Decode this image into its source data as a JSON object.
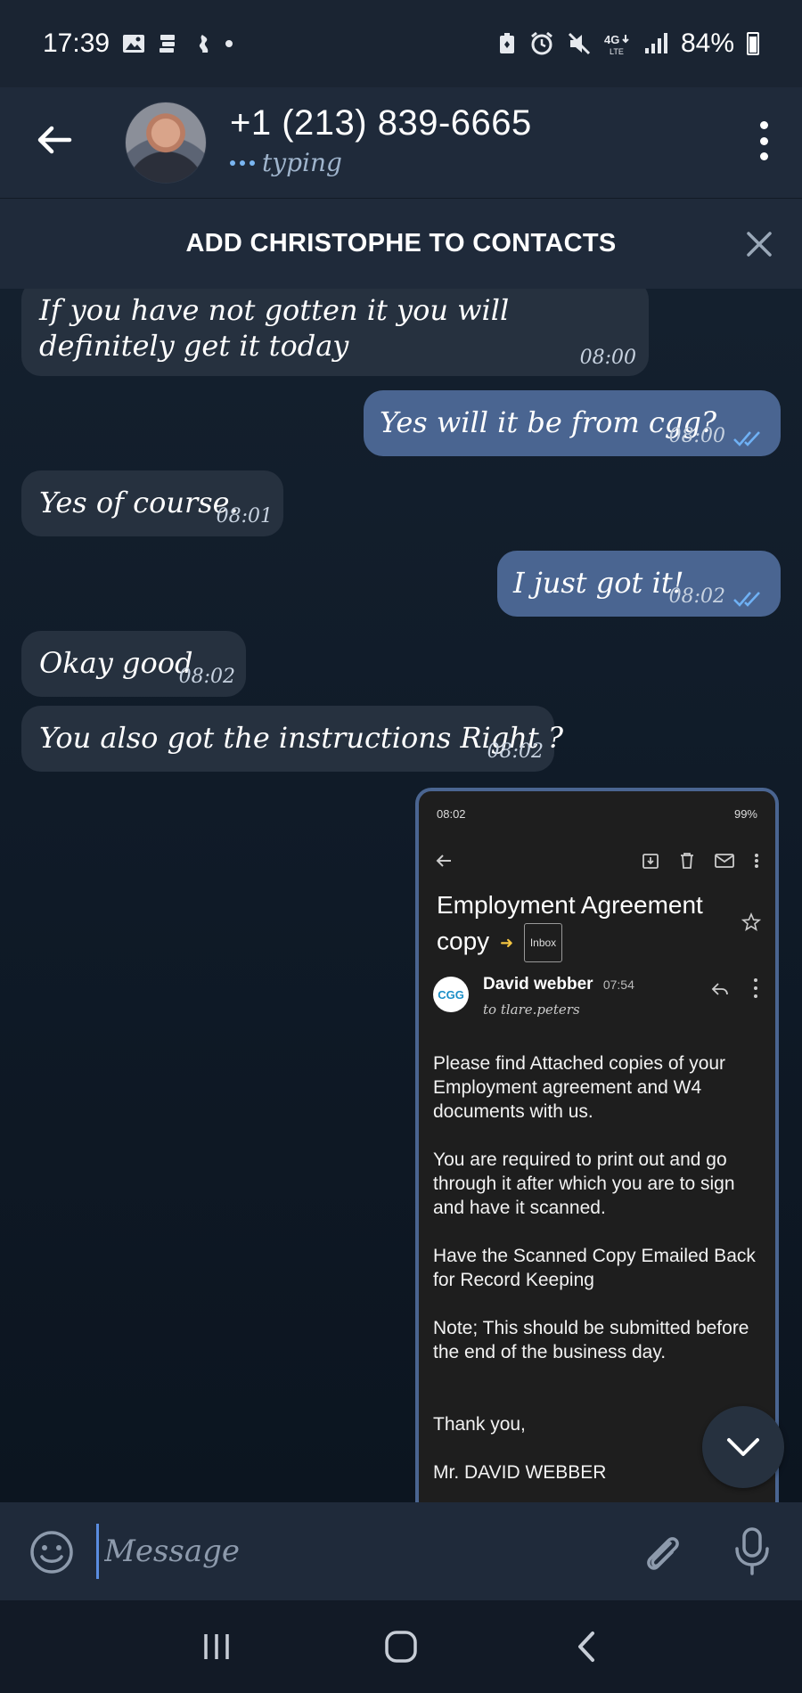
{
  "status_bar": {
    "time": "17:39",
    "battery": "84%",
    "network": "4G LTE",
    "left_icons": [
      "gallery-icon",
      "app-notification-icon",
      "telegram-notification-icon",
      "dot-icon"
    ],
    "right_icons": [
      "battery-saver-icon",
      "alarm-icon",
      "mute-icon",
      "network-icon",
      "signal-icon",
      "battery-icon"
    ]
  },
  "header": {
    "contact_name": "+1 (213) 839-6665",
    "status": "typing",
    "accent": "#7ab6f2"
  },
  "banner": {
    "label": "ADD CHRISTOPHE TO CONTACTS"
  },
  "messages": [
    {
      "direction": "in",
      "text": "If you have not gotten it you will definitely get it today",
      "time": "08:00"
    },
    {
      "direction": "out",
      "text": "Yes will it be from cgg?",
      "time": "08:00",
      "read": true
    },
    {
      "direction": "in",
      "text": "Yes of course.",
      "time": "08:01"
    },
    {
      "direction": "out",
      "text": "I just got it!",
      "time": "08:02",
      "read": true
    },
    {
      "direction": "in",
      "text": "Okay good",
      "time": "08:02"
    },
    {
      "direction": "in",
      "text": "You also got the instructions Right ?",
      "time": "08:02"
    }
  ],
  "email_screenshot": {
    "status_time": "08:02",
    "status_right": "99%",
    "subject": "Employment Agreement copy",
    "label": "Inbox",
    "sender": "David webber",
    "sender_time": "07:54",
    "recipient": "to tlare.peters",
    "avatar_text": "CGG",
    "body": [
      "Please find Attached copies of your Employment agreement and W4 documents with us.",
      "You are required to print out and go through it after which you are to sign and have it scanned.",
      "Have the Scanned Copy Emailed Back for Record Keeping",
      "Note; This should be submitted before the end of the business day.",
      "",
      "Thank you,",
      "Mr. DAVID WEBBER"
    ]
  },
  "composer": {
    "placeholder": "Message"
  },
  "colors": {
    "bubble_in": "#26313f",
    "bubble_out": "#4a6591",
    "header_bg": "#1f2a3a",
    "read_ticks": "#6fb1f5"
  }
}
